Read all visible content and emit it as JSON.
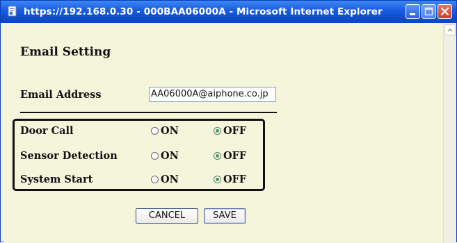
{
  "window": {
    "title": "https://192.168.0.30 - 000BAA06000A - Microsoft Internet Explorer"
  },
  "page": {
    "heading": "Email Setting",
    "email": {
      "label": "Email Address",
      "value": "AA06000A@aiphone.co.jp"
    },
    "settings": [
      {
        "label": "Door Call",
        "on_label": "ON",
        "off_label": "OFF",
        "selected": "OFF"
      },
      {
        "label": "Sensor Detection",
        "on_label": "ON",
        "off_label": "OFF",
        "selected": "OFF"
      },
      {
        "label": "System Start",
        "on_label": "ON",
        "off_label": "OFF",
        "selected": "OFF"
      }
    ],
    "buttons": {
      "cancel": "CANCEL",
      "save": "SAVE"
    }
  },
  "colors": {
    "background": "#f5f5dc",
    "titlebar": "#1b5fe0",
    "close_button": "#c6402a",
    "radio_checked": "#33aa33"
  }
}
